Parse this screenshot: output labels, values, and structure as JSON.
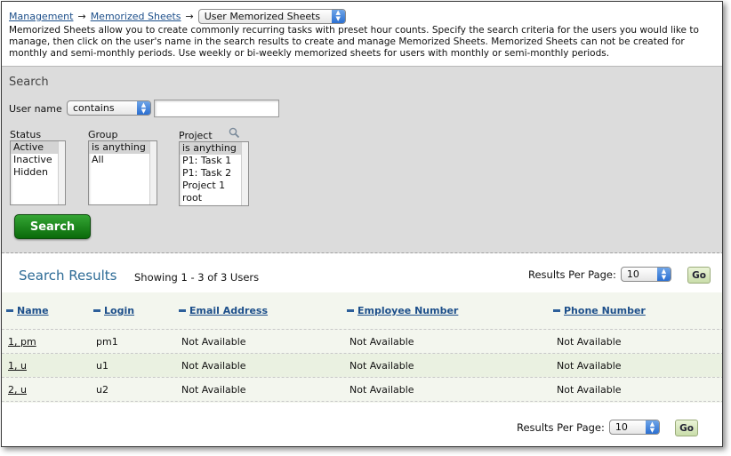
{
  "breadcrumb": {
    "items": [
      "Management",
      "Memorized Sheets"
    ],
    "arrow": "→",
    "current_select": "User Memorized Sheets"
  },
  "description": "Memorized Sheets allow you to create commonly recurring tasks with preset hour counts. Specify the search criteria for the users you would like to manage, then click on the user's name in the search results to create and manage Memorized Sheets. Memorized Sheets can not be created for monthly and semi-monthly periods. Use weekly or bi-weekly memorized sheets for users with monthly or semi-monthly periods.",
  "search": {
    "title": "Search",
    "username_label": "User name",
    "match_select": "contains",
    "username_value": "",
    "status": {
      "label": "Status",
      "options": [
        "Active",
        "Inactive",
        "Hidden"
      ]
    },
    "group": {
      "label": "Group",
      "options": [
        "is anything",
        "All"
      ]
    },
    "project": {
      "label": "Project",
      "options": [
        "is anything",
        "P1: Task 1",
        "P1: Task 2",
        "Project 1",
        "root"
      ]
    },
    "button_label": "Search"
  },
  "results": {
    "title": "Search Results",
    "showing": "Showing 1 - 3 of 3 Users",
    "per_page_label": "Results Per Page:",
    "per_page_value": "10",
    "go_label": "Go",
    "columns": [
      "Name",
      "Login",
      "Email Address",
      "Employee Number",
      "Phone Number"
    ],
    "rows": [
      {
        "name": "1, pm",
        "login": "pm1",
        "email": "Not Available",
        "employee": "Not Available",
        "phone": "Not Available"
      },
      {
        "name": "1, u",
        "login": "u1",
        "email": "Not Available",
        "employee": "Not Available",
        "phone": "Not Available"
      },
      {
        "name": "2, u",
        "login": "u2",
        "email": "Not Available",
        "employee": "Not Available",
        "phone": "Not Available"
      }
    ]
  },
  "colors": {
    "link": "#1d4f8a",
    "search_button": "#0a6a0a",
    "results_title": "#2d6b96"
  },
  "icons": {
    "project_search": "magnifier-icon",
    "select_arrows": "updown-chevron-icon"
  }
}
